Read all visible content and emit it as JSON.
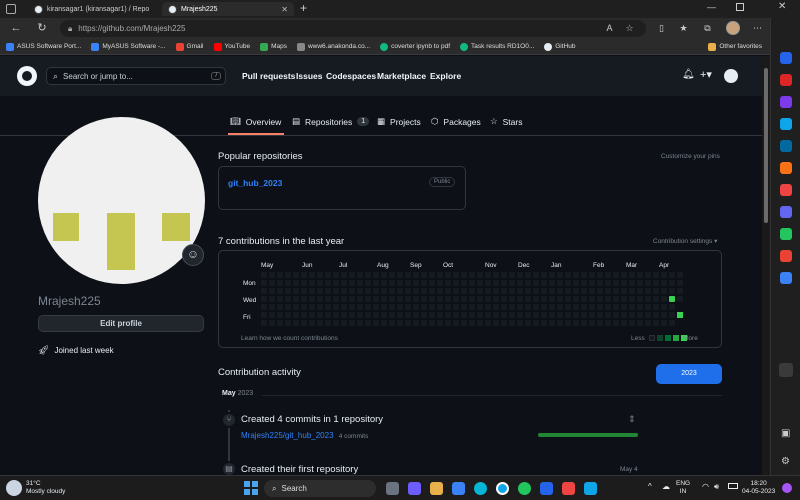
{
  "browser": {
    "tabs": [
      {
        "title": "kiransagar1 (kiransagar1) / Repo"
      },
      {
        "title": "Mrajesh225"
      }
    ],
    "url": "https://github.com/Mrajesh225",
    "bookmarks": [
      {
        "label": "ASUS Software Port...",
        "color": "#3b82f6"
      },
      {
        "label": "MyASUS Software -...",
        "color": "#3b82f6"
      },
      {
        "label": "Gmail",
        "color": "#ea4335"
      },
      {
        "label": "YouTube",
        "color": "#ff0000"
      },
      {
        "label": "Maps",
        "color": "#34a853"
      },
      {
        "label": "www6.anakonda.co...",
        "color": "#888888"
      },
      {
        "label": "coverter ipynb to pdf",
        "color": "#10b981"
      },
      {
        "label": "Task results RD1O0...",
        "color": "#10b981"
      },
      {
        "label": "GitHub",
        "color": "#e6edf3"
      }
    ],
    "other_favorites": "Other favorites"
  },
  "github": {
    "search_placeholder": "Search or jump to...",
    "search_key": "/",
    "nav": [
      "Pull requests",
      "Issues",
      "Codespaces",
      "Marketplace",
      "Explore"
    ],
    "profile_tabs": [
      {
        "label": "Overview"
      },
      {
        "label": "Repositories",
        "count": "1"
      },
      {
        "label": "Projects"
      },
      {
        "label": "Packages"
      },
      {
        "label": "Stars"
      }
    ]
  },
  "profile": {
    "username": "Mrajesh225",
    "edit_label": "Edit profile",
    "joined": "Joined last week"
  },
  "popular": {
    "heading": "Popular repositories",
    "customize": "Customize your pins",
    "repo_name": "git_hub_2023",
    "visibility": "Public"
  },
  "contributions": {
    "heading": "7 contributions in the last year",
    "settings": "Contribution settings",
    "months": [
      "May",
      "Jun",
      "Jul",
      "Aug",
      "Sep",
      "Oct",
      "Nov",
      "Dec",
      "Jan",
      "Feb",
      "Mar",
      "Apr"
    ],
    "days": [
      "Mon",
      "Wed",
      "Fri"
    ],
    "learn": "Learn how we count contributions",
    "less": "Less",
    "more": "More"
  },
  "activity": {
    "heading": "Contribution activity",
    "year_button": "2023",
    "month_label": "May",
    "month_year": "2023",
    "commit_title": "Created 4 commits in 1 repository",
    "commit_repo": "Mrajesh225/git_hub_2023",
    "commit_count": "4 commits",
    "first_repo_title": "Created their first repository",
    "first_repo_date": "May 4"
  },
  "taskbar": {
    "weather_temp": "31°C",
    "weather_desc": "Mostly cloudy",
    "search_label": "Search",
    "lang": "ENG",
    "region": "IN",
    "time": "18:20",
    "date": "04-05-2023"
  }
}
